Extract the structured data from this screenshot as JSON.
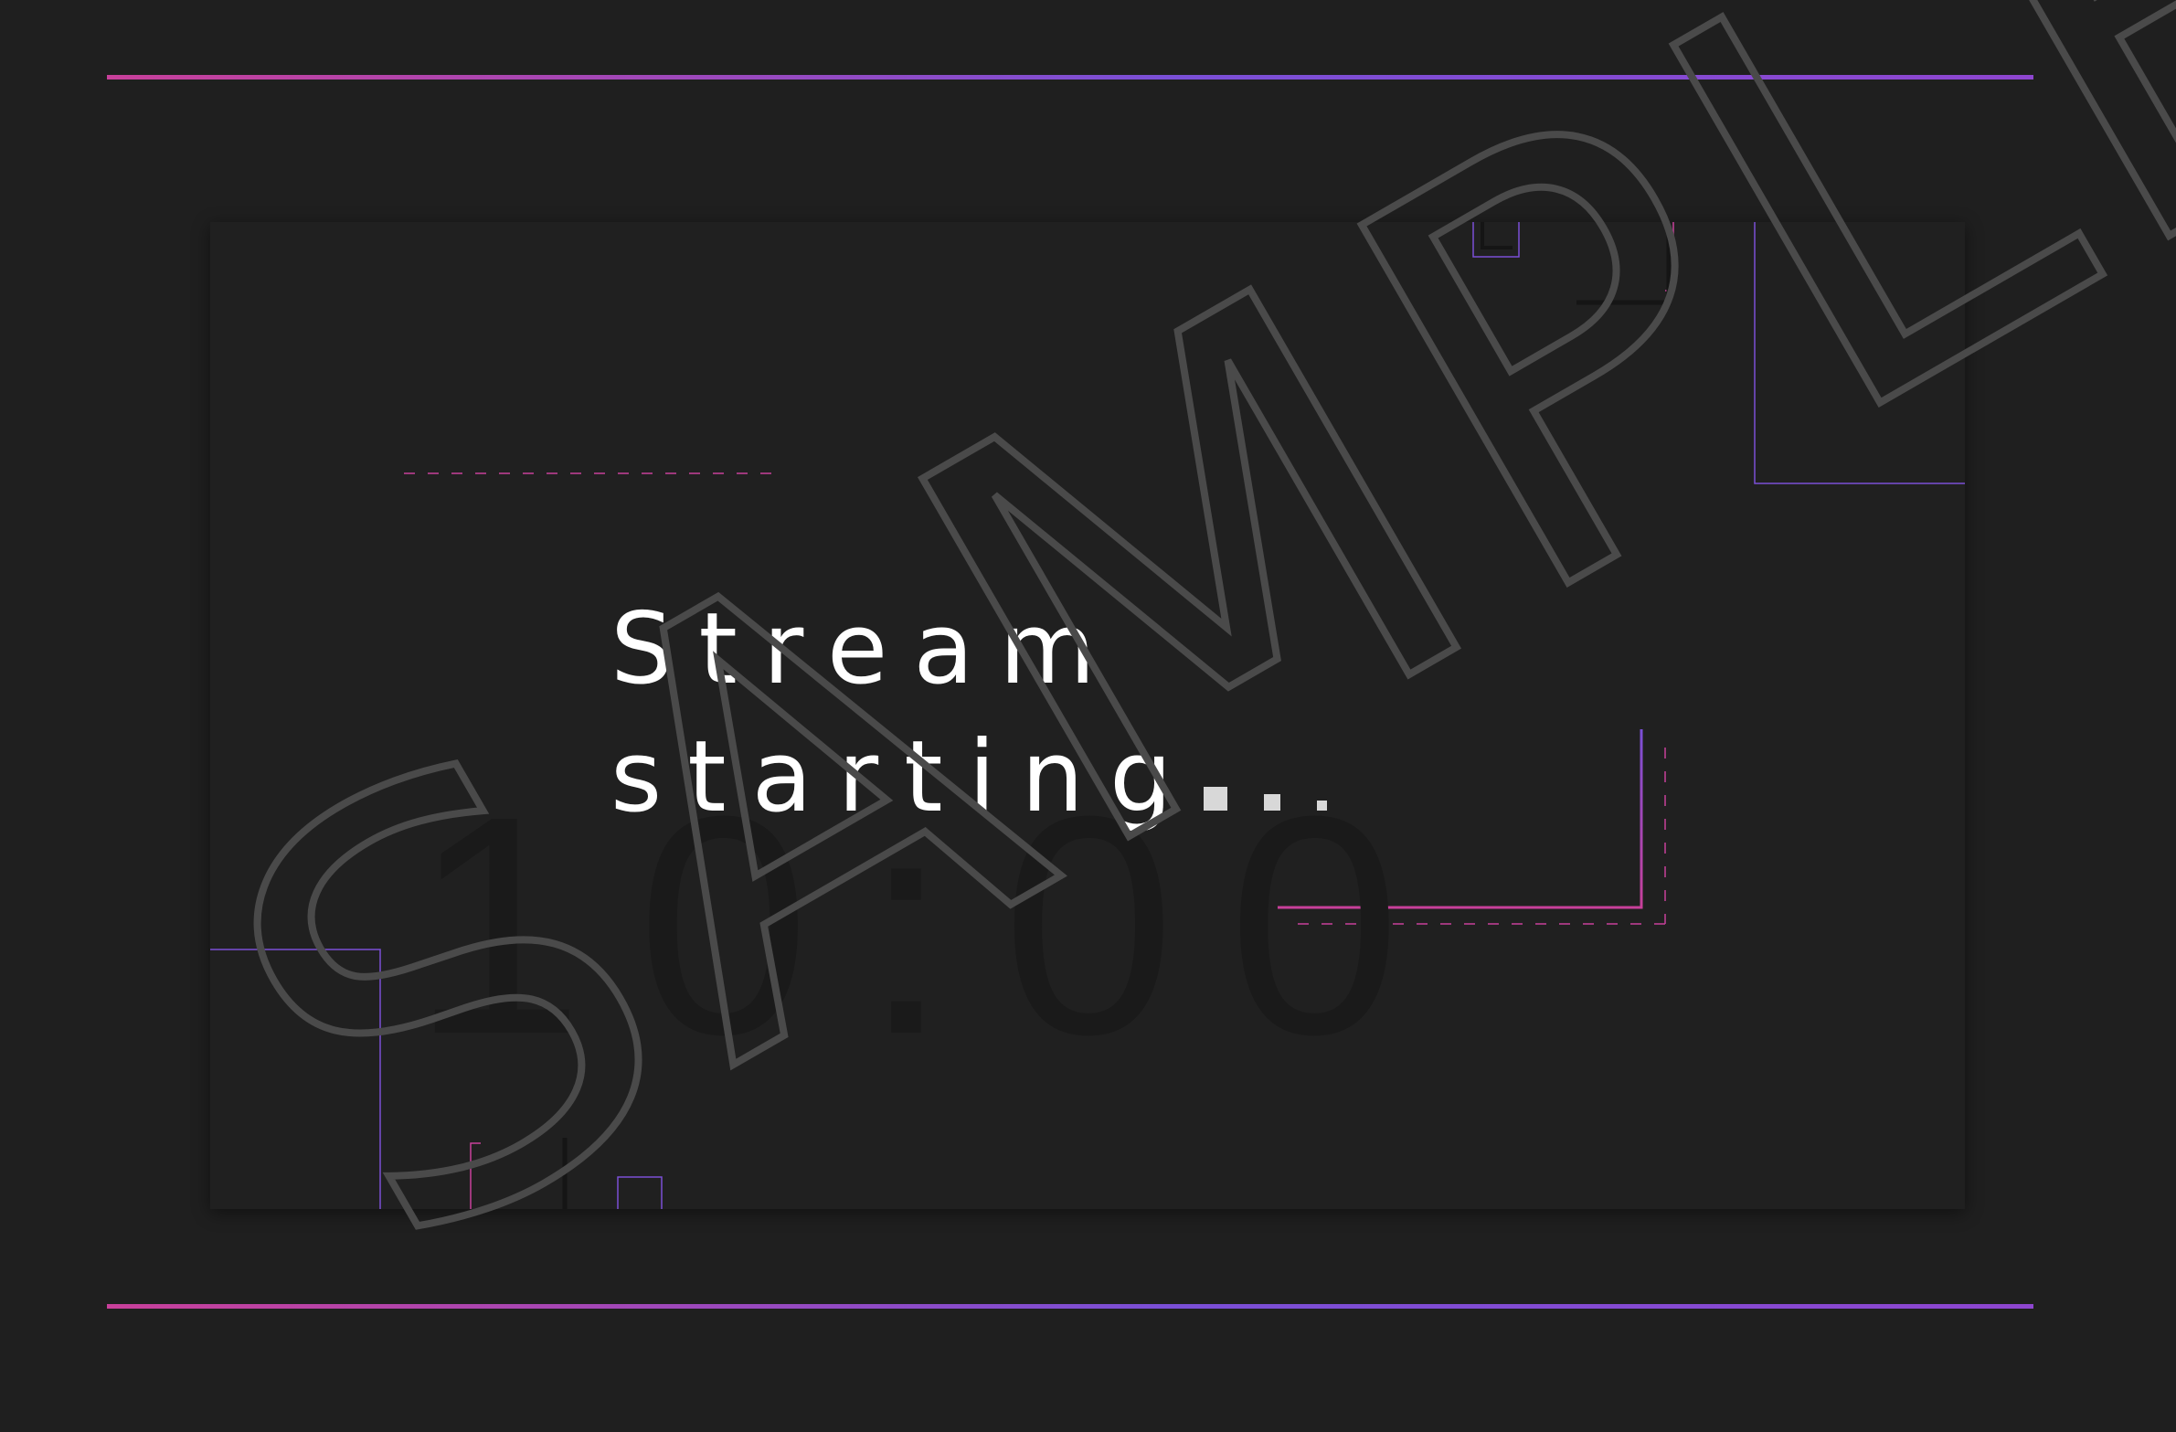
{
  "screen": {
    "title_line1": "Stream",
    "title_line2": "starting",
    "countdown": "10:00",
    "watermark": "SAMPLE"
  },
  "colors": {
    "background": "#1f1f1f",
    "scene": "#202020",
    "accent_pink": "#c8409a",
    "accent_purple": "#7a4fd6",
    "title_text": "#ffffff",
    "countdown_text": "#1a1a1a",
    "watermark_stroke": "#4a4a4a"
  }
}
